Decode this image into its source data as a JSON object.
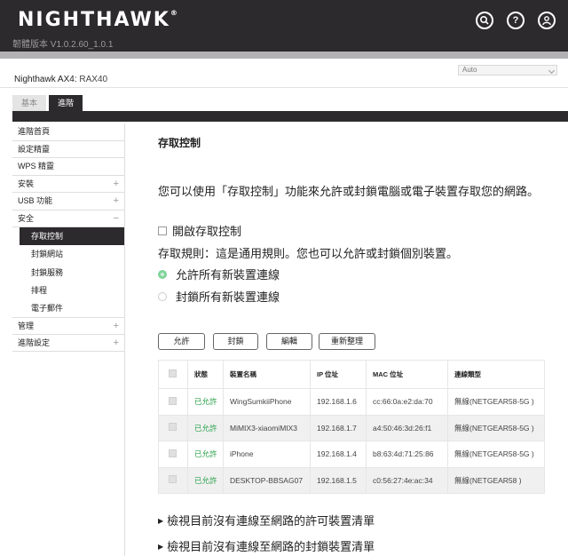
{
  "header": {
    "logo_text": "NIGHTHAWK",
    "firmware": "韌體版本 V1.0.2.60_1.0.1",
    "icons": [
      "search-icon",
      "help-icon",
      "user-icon"
    ]
  },
  "model": {
    "name": "Nighthawk AX4:",
    "number": "RAX40"
  },
  "language_select": {
    "value": "Auto"
  },
  "tabs": {
    "basic": "基本",
    "advanced": "進階"
  },
  "sidebar": {
    "items": [
      {
        "label": "進階首頁",
        "toggle": ""
      },
      {
        "label": "設定精靈",
        "toggle": ""
      },
      {
        "label": "WPS 精靈",
        "toggle": ""
      },
      {
        "label": "安裝",
        "toggle": "+"
      },
      {
        "label": "USB 功能",
        "toggle": "+"
      },
      {
        "label": "安全",
        "toggle": "−"
      }
    ],
    "security_sub": [
      {
        "label": "存取控制",
        "active": true
      },
      {
        "label": "封鎖網站",
        "active": false
      },
      {
        "label": "封鎖服務",
        "active": false
      },
      {
        "label": "排程",
        "active": false
      },
      {
        "label": "電子郵件",
        "active": false
      }
    ],
    "items_after": [
      {
        "label": "管理",
        "toggle": "+"
      },
      {
        "label": "進階設定",
        "toggle": "+"
      }
    ]
  },
  "main": {
    "title": "存取控制",
    "intro": "您可以使用「存取控制」功能來允許或封鎖電腦或電子裝置存取您的網路。",
    "enable_label": "開啟存取控制",
    "rules_text": "存取規則：這是通用規則。您也可以允許或封鎖個別裝置。",
    "radio_allow": "允許所有新裝置連線",
    "radio_block": "封鎖所有新裝置連線",
    "buttons": {
      "allow": "允許",
      "block": "封鎖",
      "edit": "編輯",
      "refresh": "重新整理"
    },
    "table": {
      "headers": [
        "狀態",
        "裝置名稱",
        "IP 位址",
        "MAC 位址",
        "連線類型"
      ],
      "rows": [
        {
          "status": "已允許",
          "name": "WingSumkiiPhone",
          "ip": "192.168.1.6",
          "mac": "cc:66:0a:e2:da:70",
          "type": "無線(NETGEAR58-5G )"
        },
        {
          "status": "已允許",
          "name": "MiMIX3-xiaomiMIX3",
          "ip": "192.168.1.7",
          "mac": "a4:50:46:3d:26:f1",
          "type": "無線(NETGEAR58-5G )"
        },
        {
          "status": "已允許",
          "name": "iPhone",
          "ip": "192.168.1.4",
          "mac": "b8:63:4d:71:25:86",
          "type": "無線(NETGEAR58-5G )"
        },
        {
          "status": "已允許",
          "name": "DESKTOP-BBSAG07",
          "ip": "192.168.1.5",
          "mac": "c0:56:27:4e:ac:34",
          "type": "無線(NETGEAR58 )"
        }
      ]
    },
    "link_allowed": "檢視目前沒有連線至網路的許可裝置清單",
    "link_blocked": "檢視目前沒有連線至網路的封鎖裝置清單"
  }
}
